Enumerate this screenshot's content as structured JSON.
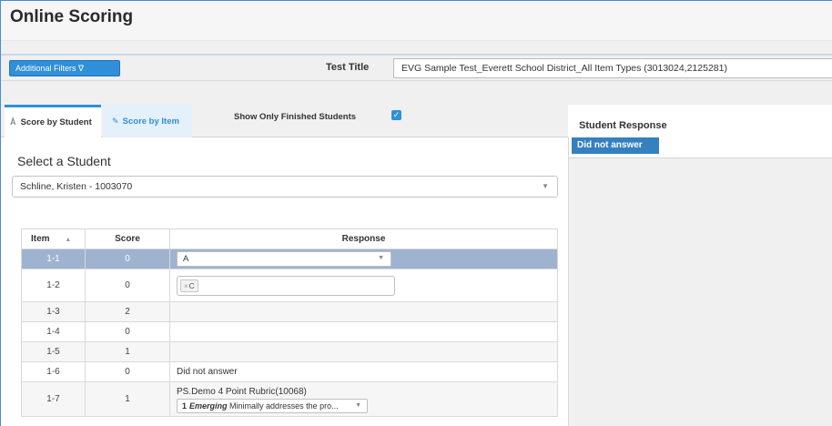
{
  "header": {
    "title": "Online Scoring"
  },
  "filters": {
    "additional_filters_label": "Additional Filters",
    "filter_icon": "filter-icon",
    "test_title_label": "Test Title",
    "test_title_value": "EVG Sample Test_Everett School District_All Item Types (3013024,2125281)"
  },
  "tabs": [
    {
      "label": "Score by Student",
      "icon": "user-icon",
      "active": true
    },
    {
      "label": "Score by Item",
      "icon": "pencil-icon",
      "active": false
    }
  ],
  "show_only_finished": {
    "label": "Show Only Finished Students",
    "checked": true
  },
  "student_select": {
    "label": "Select a Student",
    "value": "Schline, Kristen - 1003070"
  },
  "grid": {
    "headers": {
      "item": "Item",
      "score": "Score",
      "response": "Response"
    },
    "rows": [
      {
        "item": "1-1",
        "score": "0",
        "response_type": "select",
        "response": "A"
      },
      {
        "item": "1-2",
        "score": "0",
        "response_type": "multi",
        "response": "C"
      },
      {
        "item": "1-3",
        "score": "2",
        "response_type": "none",
        "response": ""
      },
      {
        "item": "1-4",
        "score": "0",
        "response_type": "none",
        "response": ""
      },
      {
        "item": "1-5",
        "score": "1",
        "response_type": "none",
        "response": ""
      },
      {
        "item": "1-6",
        "score": "0",
        "response_type": "text",
        "response": "Did not answer"
      },
      {
        "item": "1-7",
        "score": "1",
        "response_type": "rubric",
        "response": "PS.Demo 4 Point Rubric(10068)",
        "rubric": {
          "level": "1",
          "level_name": "Emerging",
          "text": "Minimally addresses the pro..."
        }
      }
    ]
  },
  "student_response": {
    "label": "Student Response",
    "badge": "Did not answer"
  },
  "colors": {
    "accent": "#2f8fd8",
    "selected_row": "#9eb3cf",
    "badge": "#3580c0"
  }
}
